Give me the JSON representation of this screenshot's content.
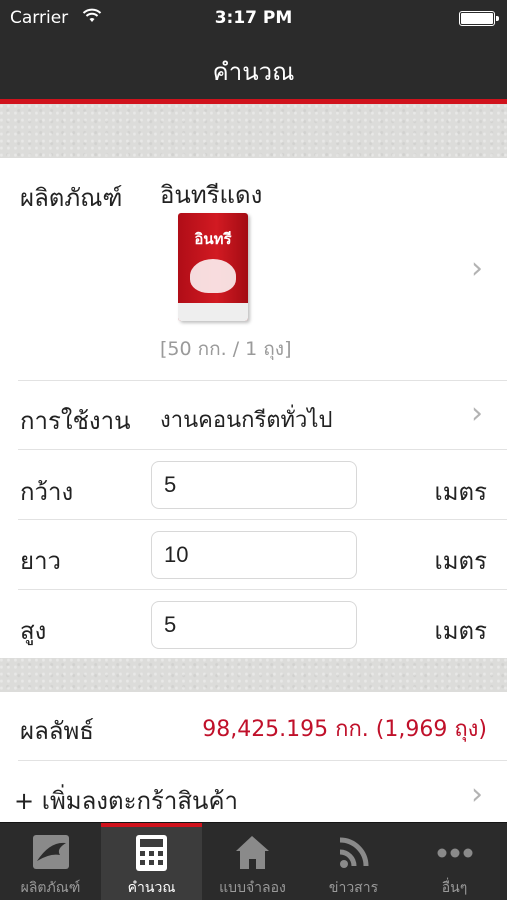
{
  "status_bar": {
    "carrier": "Carrier",
    "time": "3:17 PM"
  },
  "nav": {
    "title": "คำนวณ"
  },
  "product": {
    "label": "ผลิตภัณฑ์",
    "name": "อินทรีแดง",
    "bag_brand": "อินทรี",
    "weight_text": "[50 กก. / 1 ถุง]"
  },
  "usage": {
    "label": "การใช้งาน",
    "value": "งานคอนกรีตทั่วไป"
  },
  "dimensions": [
    {
      "label": "กว้าง",
      "value": "5",
      "unit": "เมตร"
    },
    {
      "label": "ยาว",
      "value": "10",
      "unit": "เมตร"
    },
    {
      "label": "สูง",
      "value": "5",
      "unit": "เมตร"
    }
  ],
  "result": {
    "label": "ผลลัพธ์",
    "value": "98,425.195 กก. (1,969 ถุง)"
  },
  "add_to_cart": {
    "label": "+ เพิ่มลงตะกร้าสินค้า"
  },
  "tabs": [
    {
      "label": "ผลิตภัณฑ์",
      "icon": "eagle-logo-icon",
      "active": false
    },
    {
      "label": "คำนวณ",
      "icon": "calculator-icon",
      "active": true
    },
    {
      "label": "แบบจำลอง",
      "icon": "house-icon",
      "active": false
    },
    {
      "label": "ข่าวสาร",
      "icon": "rss-icon",
      "active": false
    },
    {
      "label": "อื่นๆ",
      "icon": "more-dots-icon",
      "active": false
    }
  ],
  "colors": {
    "accent": "#d0121c",
    "result": "#c0102a",
    "bar": "#2b2b2b"
  }
}
